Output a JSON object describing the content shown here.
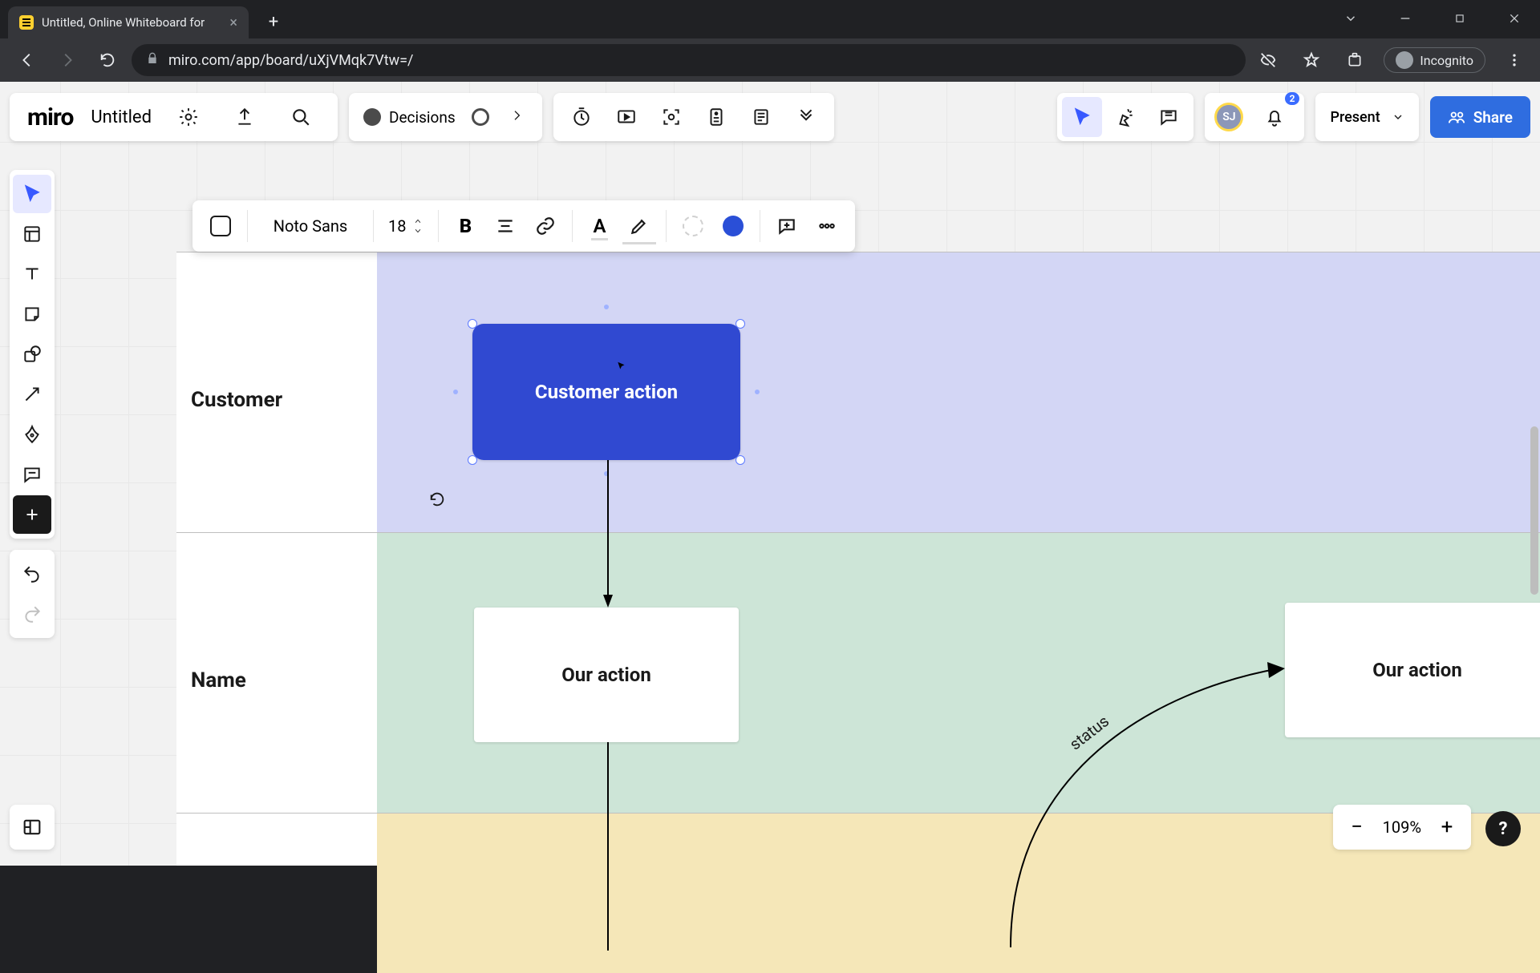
{
  "browser": {
    "tab_title": "Untitled, Online Whiteboard for",
    "url": "miro.com/app/board/uXjVMqk7Vtw=/",
    "incognito_label": "Incognito"
  },
  "header": {
    "logo_text": "miro",
    "board_title": "Untitled",
    "frames": [
      {
        "label": "Decisions",
        "style": "dark"
      }
    ],
    "present_label": "Present",
    "share_label": "Share",
    "avatar_initials": "SJ",
    "notification_count": "2"
  },
  "context_toolbar": {
    "font_family": "Noto Sans",
    "font_size": "18"
  },
  "lanes": {
    "row1_label": "Customer",
    "row2_label": "Name"
  },
  "nodes": {
    "customer_action": "Customer action",
    "our_action_1": "Our action",
    "our_action_2": "Our action",
    "edge_label": "status"
  },
  "zoom": {
    "value": "109%"
  }
}
